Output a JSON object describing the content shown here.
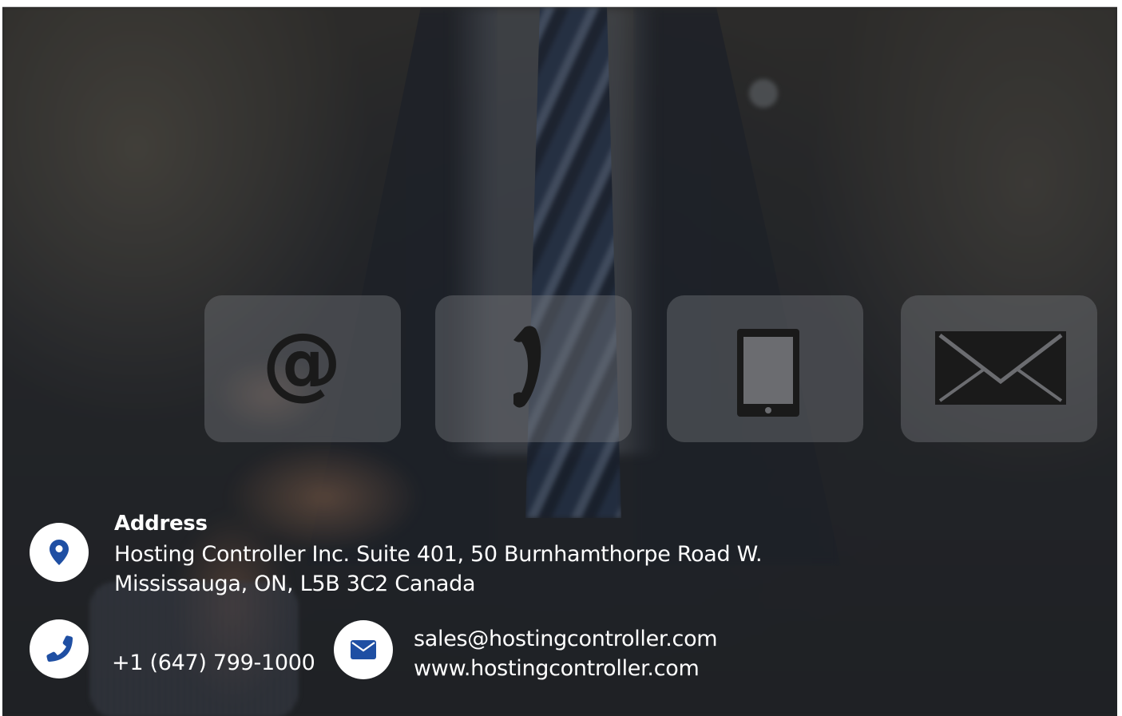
{
  "contact": {
    "address_title": "Address",
    "address_line1": "Hosting Controller Inc. Suite 401, 50 Burnhamthorpe Road W.",
    "address_line2": "Mississauga, ON, L5B 3C2 Canada",
    "phone": "+1 (647) 799-1000",
    "email": "sales@hostingcontroller.com",
    "website": "www.hostingcontroller.com"
  },
  "icons": {
    "address": "map-marker-icon",
    "phone": "phone-icon",
    "email": "envelope-icon"
  },
  "background_tiles": [
    "at-sign-icon",
    "telephone-handset-icon",
    "tablet-icon",
    "mail-envelope-icon"
  ],
  "colors": {
    "icon_accent": "#1f4fa3",
    "text": "#ffffff",
    "circle_bg": "#ffffff"
  }
}
